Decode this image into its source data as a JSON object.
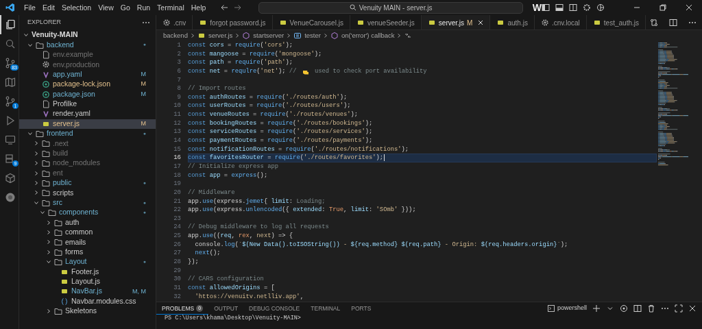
{
  "title_bar": {
    "menu": [
      "File",
      "Edit",
      "Selection",
      "View",
      "Go",
      "Run",
      "Terminal",
      "Help"
    ],
    "search": "Venuity MAIN - server.js",
    "logo": "W"
  },
  "activity_bar": [
    {
      "kind": "files",
      "selected": true
    },
    {
      "kind": "search",
      "selected": false
    },
    {
      "kind": "source-control",
      "selected": false,
      "badge": "83"
    },
    {
      "kind": "map",
      "selected": false
    },
    {
      "kind": "source-control",
      "selected": false,
      "badge": "1"
    },
    {
      "kind": "run",
      "selected": false
    },
    {
      "kind": "remote",
      "selected": false
    },
    {
      "kind": "database",
      "selected": false,
      "badge": "9"
    },
    {
      "kind": "cube",
      "selected": false
    },
    {
      "kind": "circle",
      "selected": false
    }
  ],
  "sidebar": {
    "title": "EXPLORER",
    "root": {
      "name": "Venuity-MAIN",
      "expanded": true
    },
    "tree": [
      {
        "name": "backend",
        "kind": "folder",
        "expanded": true,
        "selected": false,
        "ignored": false,
        "changed": true,
        "modified": false,
        "badge": "●",
        "children": [
          {
            "name": "env.example",
            "kind": "file",
            "selected": false,
            "ignored": true,
            "changed": false,
            "modified": false
          },
          {
            "name": "env.production",
            "kind": "gear",
            "selected": false,
            "ignored": true,
            "changed": false,
            "modified": false
          },
          {
            "name": "app.yaml",
            "kind": "yaml",
            "selected": false,
            "ignored": false,
            "changed": true,
            "modified": false,
            "badge": "M"
          },
          {
            "name": "package-lock.json",
            "kind": "json",
            "selected": false,
            "ignored": false,
            "changed": false,
            "modified": true,
            "badge": "M"
          },
          {
            "name": "package.json",
            "kind": "json",
            "selected": false,
            "ignored": false,
            "changed": true,
            "modified": false,
            "badge": "M"
          },
          {
            "name": "Profilke",
            "kind": "file",
            "selected": false,
            "ignored": false,
            "changed": false,
            "modified": false
          },
          {
            "name": "render.yaml",
            "kind": "yaml",
            "selected": false,
            "ignored": false,
            "changed": false,
            "modified": false
          },
          {
            "name": "server.js",
            "kind": "js",
            "selected": true,
            "ignored": false,
            "changed": false,
            "modified": true,
            "badge": "M"
          }
        ]
      },
      {
        "name": "frontend",
        "kind": "folder",
        "expanded": true,
        "selected": false,
        "ignored": false,
        "changed": true,
        "modified": false,
        "badge": "●",
        "children": [
          {
            "name": ".next",
            "kind": "folder",
            "expanded": false,
            "selected": false,
            "ignored": true,
            "changed": false,
            "modified": false
          },
          {
            "name": "build",
            "kind": "folder",
            "expanded": false,
            "selected": false,
            "ignored": true,
            "changed": false,
            "modified": false
          },
          {
            "name": "node_modules",
            "kind": "folder",
            "expanded": false,
            "selected": false,
            "ignored": true,
            "changed": false,
            "modified": false
          },
          {
            "name": "ent",
            "kind": "folder",
            "expanded": false,
            "selected": false,
            "ignored": true,
            "changed": false,
            "modified": false
          },
          {
            "name": "public",
            "kind": "folder",
            "expanded": false,
            "selected": false,
            "ignored": false,
            "changed": true,
            "modified": false,
            "badge": "●"
          },
          {
            "name": "scripts",
            "kind": "folder",
            "expanded": false,
            "selected": false,
            "ignored": false,
            "changed": false,
            "modified": false
          },
          {
            "name": "src",
            "kind": "folder",
            "expanded": true,
            "selected": false,
            "ignored": false,
            "changed": true,
            "modified": false,
            "badge": "●",
            "children": [
              {
                "name": "components",
                "kind": "folder",
                "expanded": true,
                "selected": false,
                "ignored": false,
                "changed": true,
                "modified": false,
                "badge": "●",
                "children": [
                  {
                    "name": "auth",
                    "kind": "folder",
                    "expanded": false,
                    "selected": false,
                    "ignored": false,
                    "changed": false,
                    "modified": false
                  },
                  {
                    "name": "common",
                    "kind": "folder",
                    "expanded": false,
                    "selected": false,
                    "ignored": false,
                    "changed": false,
                    "modified": false
                  },
                  {
                    "name": "emails",
                    "kind": "folder",
                    "expanded": false,
                    "selected": false,
                    "ignored": false,
                    "changed": false,
                    "modified": false
                  },
                  {
                    "name": "forms",
                    "kind": "folder",
                    "expanded": false,
                    "selected": false,
                    "ignored": false,
                    "changed": false,
                    "modified": false
                  },
                  {
                    "name": "Layout",
                    "kind": "folder",
                    "expanded": true,
                    "selected": false,
                    "ignored": false,
                    "changed": true,
                    "modified": false,
                    "badge": "●",
                    "children": [
                      {
                        "name": "Footer.js",
                        "kind": "js",
                        "selected": false,
                        "ignored": false,
                        "changed": false,
                        "modified": false
                      },
                      {
                        "name": "Layout.js",
                        "kind": "js",
                        "selected": false,
                        "ignored": false,
                        "changed": false,
                        "modified": false
                      },
                      {
                        "name": "NavBar.js",
                        "kind": "js",
                        "selected": false,
                        "ignored": false,
                        "changed": true,
                        "modified": false,
                        "badge": "M, M"
                      },
                      {
                        "name": "Navbar.modules.css",
                        "kind": "css",
                        "selected": false,
                        "ignored": false,
                        "changed": false,
                        "modified": false
                      }
                    ]
                  },
                  {
                    "name": "Skeletons",
                    "kind": "folder",
                    "expanded": false,
                    "selected": false,
                    "ignored": false,
                    "changed": false,
                    "modified": false
                  }
                ]
              }
            ]
          }
        ]
      }
    ]
  },
  "tabs": [
    {
      "label": ".cnv",
      "kind": "gear",
      "selected": false
    },
    {
      "label": "forgot password.js",
      "kind": "js",
      "selected": false
    },
    {
      "label": "VenueCarousel.js",
      "kind": "js",
      "selected": false
    },
    {
      "label": "venueSeeder.js",
      "kind": "js",
      "selected": false
    },
    {
      "label": "server.js",
      "kind": "js",
      "selected": true,
      "status": "M"
    },
    {
      "label": "auth.js",
      "kind": "js",
      "selected": false
    },
    {
      "label": ".cnv.local",
      "kind": "gear",
      "selected": false
    },
    {
      "label": "test_auth.js",
      "kind": "js",
      "selected": false
    }
  ],
  "breadcrumb": [
    {
      "label": "backend",
      "kind": "folder"
    },
    {
      "label": "server.js",
      "kind": "js"
    },
    {
      "label": "startserver",
      "kind": "function"
    },
    {
      "label": "tester",
      "kind": "variable"
    },
    {
      "label": "on('error') callback",
      "kind": "function"
    },
    {
      "kind": "symbol"
    }
  ],
  "code": [
    {
      "num": "1",
      "current": false,
      "tokens": [
        {
          "kind": "kw",
          "text": "const"
        },
        {
          "kind": "var",
          "text": " cors "
        },
        {
          "kind": "pl",
          "text": "= "
        },
        {
          "kind": "fn",
          "text": "require"
        },
        {
          "kind": "pl",
          "text": "("
        },
        {
          "kind": "str",
          "text": "'cors'"
        },
        {
          "kind": "pl",
          "text": ");"
        }
      ]
    },
    {
      "num": "2",
      "current": false,
      "tokens": [
        {
          "kind": "kw",
          "text": "const"
        },
        {
          "kind": "var",
          "text": " mangoose "
        },
        {
          "kind": "pl",
          "text": "= "
        },
        {
          "kind": "fn",
          "text": "require"
        },
        {
          "kind": "pl",
          "text": "("
        },
        {
          "kind": "str",
          "text": "'mongoose'"
        },
        {
          "kind": "pl",
          "text": ");"
        }
      ]
    },
    {
      "num": "3",
      "current": false,
      "tokens": [
        {
          "kind": "kw",
          "text": "const"
        },
        {
          "kind": "var",
          "text": " path "
        },
        {
          "kind": "pl",
          "text": "= "
        },
        {
          "kind": "fn",
          "text": "require"
        },
        {
          "kind": "pl",
          "text": "("
        },
        {
          "kind": "str",
          "text": "'path'"
        },
        {
          "kind": "pl",
          "text": ");"
        }
      ]
    },
    {
      "num": "6",
      "current": false,
      "tokens": [
        {
          "kind": "kw",
          "text": "const"
        },
        {
          "kind": "var",
          "text": " net "
        },
        {
          "kind": "pl",
          "text": "= "
        },
        {
          "kind": "fn",
          "text": "requlre"
        },
        {
          "kind": "pl",
          "text": "("
        },
        {
          "kind": "str",
          "text": "'net'"
        },
        {
          "kind": "pl",
          "text": "); "
        },
        {
          "kind": "cm",
          "text": "// "
        },
        {
          "kind": "emoji"
        },
        {
          "kind": "cm",
          "text": " used to check port availability"
        }
      ]
    },
    {
      "num": "7",
      "current": false
    },
    {
      "num": "8",
      "current": false,
      "tokens": [
        {
          "kind": "cm",
          "text": "// Import routes"
        }
      ]
    },
    {
      "num": "9",
      "current": false,
      "tokens": [
        {
          "kind": "kw",
          "text": "const"
        },
        {
          "kind": "var",
          "text": " authRoutes "
        },
        {
          "kind": "pl",
          "text": "= "
        },
        {
          "kind": "fn",
          "text": "require"
        },
        {
          "kind": "pl",
          "text": "("
        },
        {
          "kind": "str",
          "text": "'./routes/auth'"
        },
        {
          "kind": "pl",
          "text": ");"
        }
      ]
    },
    {
      "num": "10",
      "current": false,
      "tokens": [
        {
          "kind": "kw",
          "text": "const"
        },
        {
          "kind": "var",
          "text": " userRoutes "
        },
        {
          "kind": "pl",
          "text": "= "
        },
        {
          "kind": "fn",
          "text": "require"
        },
        {
          "kind": "pl",
          "text": "("
        },
        {
          "kind": "str",
          "text": "'./routes/users'"
        },
        {
          "kind": "pl",
          "text": ");"
        }
      ]
    },
    {
      "num": "11",
      "current": false,
      "tokens": [
        {
          "kind": "kw",
          "text": "const"
        },
        {
          "kind": "var",
          "text": " venueRoutes "
        },
        {
          "kind": "pl",
          "text": "= "
        },
        {
          "kind": "fn",
          "text": "require"
        },
        {
          "kind": "pl",
          "text": "("
        },
        {
          "kind": "str",
          "text": "'./routes/venues'"
        },
        {
          "kind": "pl",
          "text": ");"
        }
      ]
    },
    {
      "num": "12",
      "current": false,
      "tokens": [
        {
          "kind": "kw",
          "text": "const"
        },
        {
          "kind": "var",
          "text": " bookingRoutes "
        },
        {
          "kind": "pl",
          "text": "= "
        },
        {
          "kind": "fn",
          "text": "require"
        },
        {
          "kind": "pl",
          "text": "("
        },
        {
          "kind": "str",
          "text": "'./routes/bookings'"
        },
        {
          "kind": "pl",
          "text": ");"
        }
      ]
    },
    {
      "num": "13",
      "current": false,
      "tokens": [
        {
          "kind": "kw",
          "text": "const"
        },
        {
          "kind": "var",
          "text": " serviceRoutes "
        },
        {
          "kind": "pl",
          "text": "= "
        },
        {
          "kind": "fn",
          "text": "require"
        },
        {
          "kind": "pl",
          "text": "("
        },
        {
          "kind": "str",
          "text": "'./routes/services'"
        },
        {
          "kind": "pl",
          "text": ");"
        }
      ]
    },
    {
      "num": "14",
      "current": false,
      "tokens": [
        {
          "kind": "kw",
          "text": "const"
        },
        {
          "kind": "var",
          "text": " paymentRoutes "
        },
        {
          "kind": "pl",
          "text": "= "
        },
        {
          "kind": "fn",
          "text": "require"
        },
        {
          "kind": "pl",
          "text": "("
        },
        {
          "kind": "str",
          "text": "'./routes/payments'"
        },
        {
          "kind": "pl",
          "text": ");"
        }
      ]
    },
    {
      "num": "15",
      "current": false,
      "tokens": [
        {
          "kind": "kw",
          "text": "const"
        },
        {
          "kind": "var",
          "text": " notificationRoutes "
        },
        {
          "kind": "pl",
          "text": "= "
        },
        {
          "kind": "fn",
          "text": "require"
        },
        {
          "kind": "pl",
          "text": "("
        },
        {
          "kind": "str",
          "text": "'./routes/notifications'"
        },
        {
          "kind": "pl",
          "text": ");"
        }
      ]
    },
    {
      "num": "16",
      "current": true,
      "tokens": [
        {
          "kind": "kw",
          "text": "const"
        },
        {
          "kind": "var",
          "text": " favoritesRouter "
        },
        {
          "kind": "pl",
          "text": "= "
        },
        {
          "kind": "fn",
          "text": "require"
        },
        {
          "kind": "pl",
          "text": "("
        },
        {
          "kind": "str",
          "text": "'./routes/favorites'"
        },
        {
          "kind": "pl",
          "text": ");"
        }
      ]
    },
    {
      "num": "17",
      "current": false,
      "tokens": [
        {
          "kind": "cm",
          "text": "// Initialize express app"
        }
      ]
    },
    {
      "num": "18",
      "current": false,
      "tokens": [
        {
          "kind": "kw",
          "text": "const"
        },
        {
          "kind": "var",
          "text": " app "
        },
        {
          "kind": "pl",
          "text": "= "
        },
        {
          "kind": "fn",
          "text": "express"
        },
        {
          "kind": "pl",
          "text": "();"
        }
      ]
    },
    {
      "num": "19",
      "current": false
    },
    {
      "num": "20",
      "current": false,
      "tokens": [
        {
          "kind": "cm",
          "text": "// Middleware"
        }
      ]
    },
    {
      "num": "21",
      "current": false,
      "tokens": [
        {
          "kind": "pl",
          "text": "app."
        },
        {
          "kind": "fn",
          "text": "use"
        },
        {
          "kind": "pl",
          "text": "(express."
        },
        {
          "kind": "fn",
          "text": "jemet"
        },
        {
          "kind": "pl",
          "text": "{ "
        },
        {
          "kind": "prop",
          "text": "limit"
        },
        {
          "kind": "pl",
          "text": ": "
        },
        {
          "kind": "cm",
          "text": "Loading;"
        }
      ]
    },
    {
      "num": "22",
      "current": false,
      "tokens": [
        {
          "kind": "pl",
          "text": "app."
        },
        {
          "kind": "fn",
          "text": "use"
        },
        {
          "kind": "pl",
          "text": "(express."
        },
        {
          "kind": "fn",
          "text": "unlencoded"
        },
        {
          "kind": "pl",
          "text": "({ "
        },
        {
          "kind": "prop",
          "text": "extended"
        },
        {
          "kind": "pl",
          "text": ": "
        },
        {
          "kind": "bool",
          "text": "True"
        },
        {
          "kind": "pl",
          "text": ", "
        },
        {
          "kind": "prop",
          "text": "limit"
        },
        {
          "kind": "pl",
          "text": ": "
        },
        {
          "kind": "str",
          "text": "'SOmb'"
        },
        {
          "kind": "pl",
          "text": " }));"
        }
      ]
    },
    {
      "num": "23",
      "current": false
    },
    {
      "num": "24",
      "current": false,
      "tokens": [
        {
          "kind": "cm",
          "text": "// Debug middleware to log all requests"
        }
      ]
    },
    {
      "num": "25",
      "current": false,
      "tokens": [
        {
          "kind": "pl",
          "text": "app."
        },
        {
          "kind": "fn",
          "text": "use"
        },
        {
          "kind": "pl",
          "text": "(("
        },
        {
          "kind": "prop",
          "text": "req"
        },
        {
          "kind": "pl",
          "text": ", "
        },
        {
          "kind": "bool",
          "text": "rex"
        },
        {
          "kind": "pl",
          "text": ", "
        },
        {
          "kind": "str",
          "text": "next"
        },
        {
          "kind": "pl",
          "text": ") => {"
        }
      ]
    },
    {
      "num": "26",
      "current": false,
      "tokens": [
        {
          "kind": "pl",
          "text": "  console."
        },
        {
          "kind": "fn",
          "text": "log"
        },
        {
          "kind": "pl",
          "text": "("
        },
        {
          "kind": "str",
          "text": "`"
        },
        {
          "kind": "var",
          "text": "$(New Data().toISOString())"
        },
        {
          "kind": "str",
          "text": " - "
        },
        {
          "kind": "var",
          "text": "${req.method} $(req.path}"
        },
        {
          "kind": "str",
          "text": " - Origin: "
        },
        {
          "kind": "var",
          "text": "$(req.headers.origin}"
        },
        {
          "kind": "str",
          "text": "`"
        },
        {
          "kind": "pl",
          "text": ");"
        }
      ]
    },
    {
      "num": "27",
      "current": false,
      "tokens": [
        {
          "kind": "fn",
          "text": "  next"
        },
        {
          "kind": "pl",
          "text": "();"
        }
      ]
    },
    {
      "num": "28",
      "current": false,
      "tokens": [
        {
          "kind": "pl",
          "text": "});"
        }
      ]
    },
    {
      "num": "29",
      "current": false
    },
    {
      "num": "30",
      "current": false,
      "tokens": [
        {
          "kind": "cm",
          "text": "// CARS configuration"
        }
      ]
    },
    {
      "num": "31",
      "current": false,
      "tokens": [
        {
          "kind": "kw",
          "text": "const"
        },
        {
          "kind": "var",
          "text": " allowedOrigins "
        },
        {
          "kind": "pl",
          "text": "= ["
        }
      ]
    },
    {
      "num": "32",
      "current": false,
      "tokens": [
        {
          "kind": "str",
          "text": "  'httos://venuitv.netlliv.app'"
        },
        {
          "kind": "pl",
          "text": ","
        }
      ]
    }
  ],
  "panel": {
    "tabs": [
      {
        "label": "PROBLEMS",
        "count": "0",
        "selected": true
      },
      {
        "label": "OUTPUT",
        "selected": false
      },
      {
        "label": "DEBUG CONSOLE",
        "selected": false
      },
      {
        "label": "TERMINAL",
        "selected": false
      },
      {
        "label": "PORTS",
        "selected": false
      }
    ],
    "terminal_name": "powershell",
    "terminal_lines": [
      "PS C:\\Users\\khama\\Desktop\\Venuity-MAIN>"
    ]
  }
}
